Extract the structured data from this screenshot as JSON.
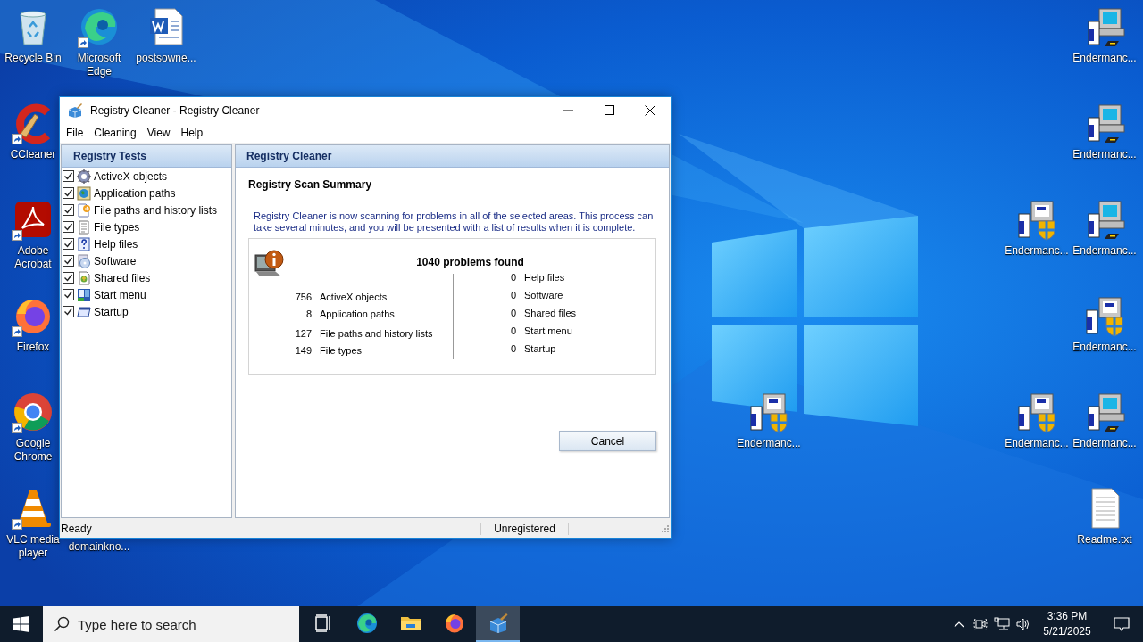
{
  "desktop": {
    "icons": [
      {
        "label": "Recycle Bin",
        "kind": "recycle",
        "shortcut": false
      },
      {
        "label": "Microsoft Edge",
        "kind": "edge",
        "shortcut": true
      },
      {
        "label": "postsowne...",
        "kind": "word",
        "shortcut": false
      },
      {
        "label": "Endermanc...",
        "kind": "installer",
        "shortcut": false
      },
      {
        "label": "CCleaner",
        "kind": "ccleaner",
        "shortcut": true
      },
      {
        "label": "Endermanc...",
        "kind": "installer",
        "shortcut": false
      },
      {
        "label": "Adobe Acrobat",
        "kind": "acrobat",
        "shortcut": true
      },
      {
        "label": "Endermanc...",
        "kind": "setup",
        "shortcut": false
      },
      {
        "label": "Endermanc...",
        "kind": "installer",
        "shortcut": false
      },
      {
        "label": "Firefox",
        "kind": "firefox",
        "shortcut": true
      },
      {
        "label": "Endermanc...",
        "kind": "setup",
        "shortcut": false
      },
      {
        "label": "Google Chrome",
        "kind": "chrome",
        "shortcut": true
      },
      {
        "label": "Endermanc...",
        "kind": "setup",
        "shortcut": false
      },
      {
        "label": "Endermanc...",
        "kind": "setup",
        "shortcut": false
      },
      {
        "label": "Endermanc...",
        "kind": "installer",
        "shortcut": false
      },
      {
        "label": "VLC media player",
        "kind": "vlc",
        "shortcut": true
      },
      {
        "label": "domainkno...",
        "kind": "hidden"
      },
      {
        "label": "Readme.txt",
        "kind": "text",
        "shortcut": false
      }
    ]
  },
  "window": {
    "title": "Registry Cleaner - Registry Cleaner",
    "menu": [
      "File",
      "Cleaning",
      "View",
      "Help"
    ],
    "tests": {
      "header": "Registry Tests",
      "items": [
        {
          "label": "ActiveX objects",
          "kind": "gear",
          "checked": true
        },
        {
          "label": "Application paths",
          "kind": "globe",
          "checked": true
        },
        {
          "label": "File paths and history lists",
          "kind": "paths",
          "checked": true
        },
        {
          "label": "File types",
          "kind": "list",
          "checked": true
        },
        {
          "label": "Help files",
          "kind": "help",
          "checked": true
        },
        {
          "label": "Software",
          "kind": "cd",
          "checked": true
        },
        {
          "label": "Shared files",
          "kind": "shared",
          "checked": true
        },
        {
          "label": "Start menu",
          "kind": "start",
          "checked": true
        },
        {
          "label": "Startup",
          "kind": "startup",
          "checked": true
        }
      ]
    },
    "content": {
      "header": "Registry Cleaner",
      "heading": "Registry Scan Summary",
      "description": "Registry Cleaner is now scanning for problems in all of the selected areas. This process can take several minutes, and you will be presented with a list of results when it is complete.",
      "summary": {
        "total": "1040 problems found",
        "left": [
          {
            "count": "756",
            "label": "ActiveX objects"
          },
          {
            "count": "8",
            "label": "Application paths"
          },
          {
            "count": "127",
            "label": "File paths and history lists"
          },
          {
            "count": "149",
            "label": "File types"
          }
        ],
        "right": [
          {
            "count": "0",
            "label": "Help files"
          },
          {
            "count": "0",
            "label": "Software"
          },
          {
            "count": "0",
            "label": "Shared files"
          },
          {
            "count": "0",
            "label": "Start menu"
          },
          {
            "count": "0",
            "label": "Startup"
          }
        ]
      },
      "button": "Cancel"
    },
    "status_bar": [
      "Ready",
      "Unregistered"
    ]
  },
  "taskbar": {
    "search_placeholder": "Type here to search",
    "apps": [
      {
        "kind": "taskview",
        "active": false
      },
      {
        "kind": "edge",
        "active": false
      },
      {
        "kind": "explorer",
        "active": false
      },
      {
        "kind": "firefox",
        "active": false
      },
      {
        "kind": "registry",
        "active": true
      }
    ],
    "time": "3:36 PM",
    "date": "5/21/2025"
  }
}
